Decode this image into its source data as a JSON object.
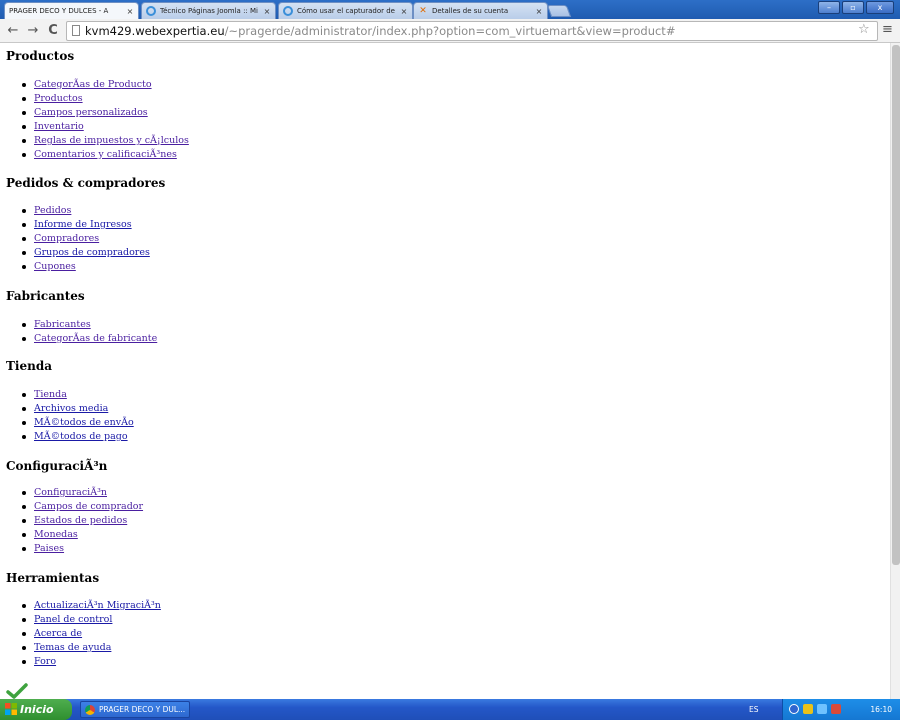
{
  "browser": {
    "tabs": [
      {
        "title": "PRAGER DECO Y DULCES - A",
        "icon": "page-icon",
        "active": true
      },
      {
        "title": "Técnico Páginas Joomla :: Mi",
        "icon": "joomla-icon",
        "active": false
      },
      {
        "title": "Cómo usar el capturador de",
        "icon": "joomla-icon",
        "active": false
      },
      {
        "title": "Detalles de su cuenta",
        "icon": "x-logo-icon",
        "active": false
      }
    ],
    "close_glyph": "×",
    "window_buttons": {
      "minimize": "–",
      "maximize": "▫",
      "close": "x"
    },
    "back_glyph": "←",
    "forward_glyph": "→",
    "reload_glyph": "C",
    "url_host": "kvm429.webexpertia.eu",
    "url_path": "/~pragerde/administrator/index.php?option=com_virtuemart&view=product#",
    "star_glyph": "☆",
    "menu_glyph": "≡"
  },
  "sections": [
    {
      "title": "Productos",
      "links": [
        "CategorÃas de Producto",
        "Productos",
        "Campos personalizados",
        "Inventario",
        "Reglas de impuestos y cÃ¡lculos",
        "Comentarios y calificaciÃ³nes"
      ]
    },
    {
      "title": "Pedidos & compradores",
      "links": [
        "Pedidos",
        "Informe de Ingresos",
        "Compradores",
        "Grupos de compradores",
        "Cupones"
      ]
    },
    {
      "title": "Fabricantes",
      "links": [
        "Fabricantes",
        "CategorÃas de fabricante"
      ]
    },
    {
      "title": "Tienda",
      "links": [
        "Tienda",
        "Archivos media",
        "MÃ©todos de envÃo",
        "MÃ©todos de pago"
      ]
    },
    {
      "title": "ConfiguraciÃ³n",
      "links": [
        "ConfiguraciÃ³n",
        "Campos de comprador",
        "Estados de pedidos",
        "Monedas",
        "Paises"
      ]
    },
    {
      "title": "Herramientas",
      "links": [
        "ActualizaciÃ³n MigraciÃ³n",
        "Panel de control",
        "Acerca de",
        "Temas de ayuda",
        "Foro"
      ]
    }
  ],
  "taskbar": {
    "start_label": "Inicio",
    "task_label": "PRAGER DECO Y DUL...",
    "language": "ES",
    "clock": "16:10"
  }
}
